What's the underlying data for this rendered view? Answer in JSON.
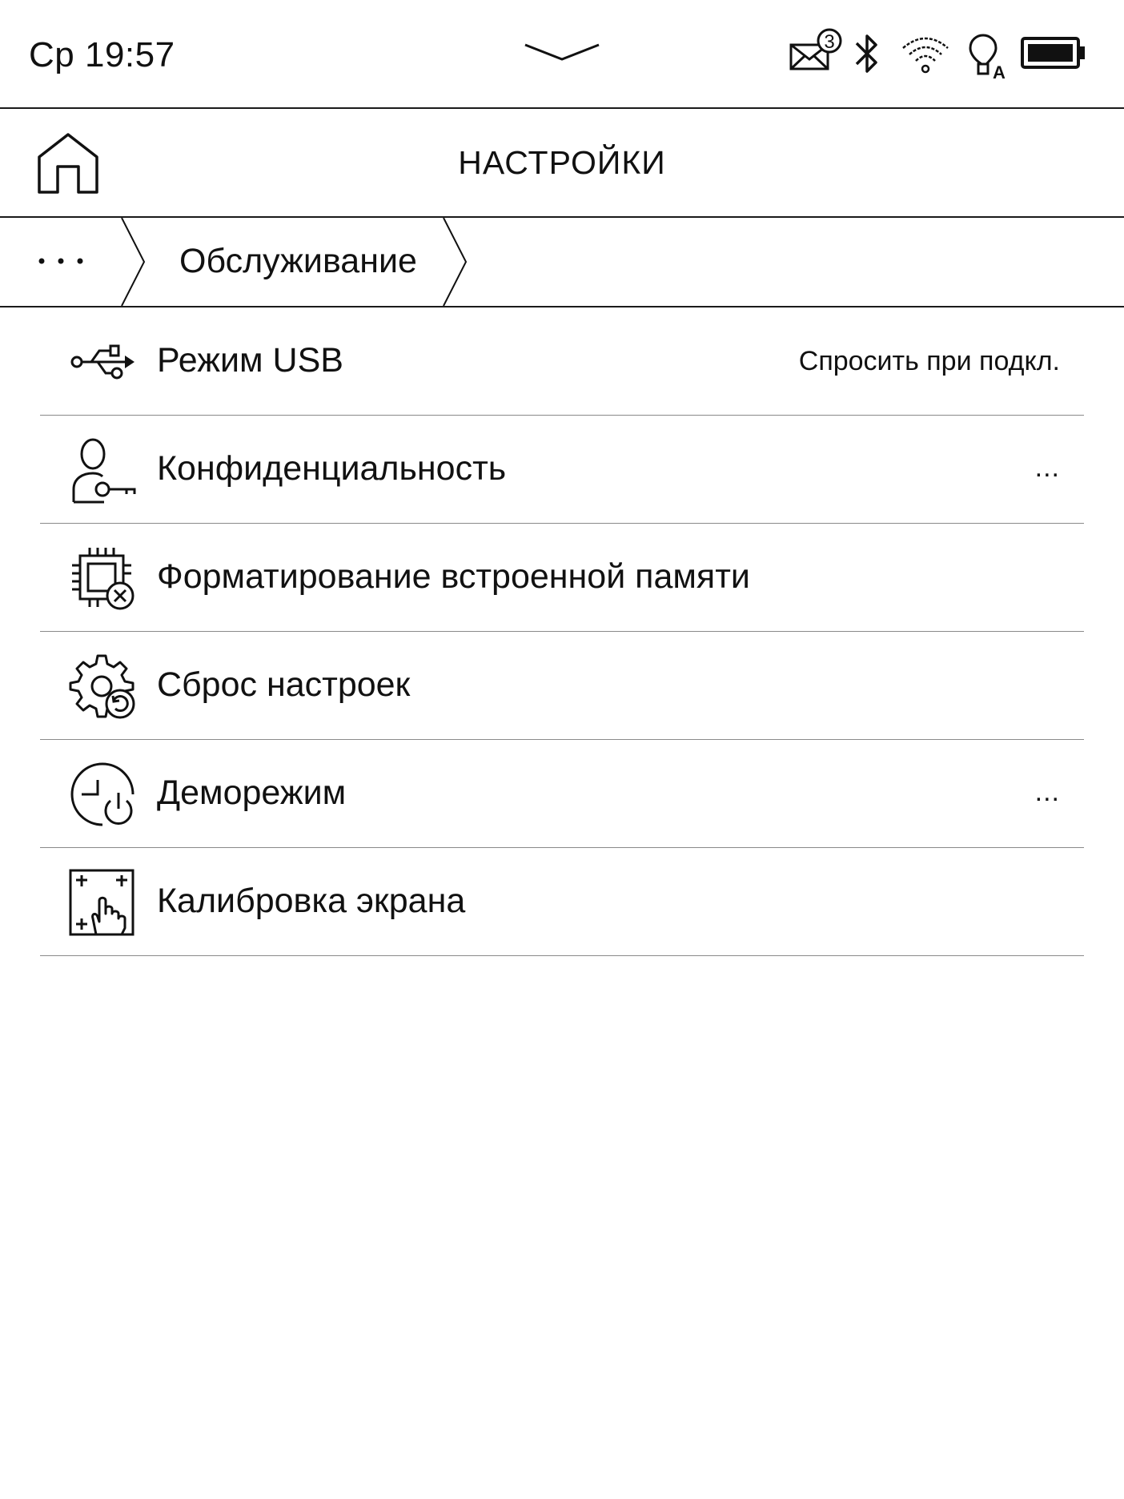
{
  "status_bar": {
    "time": "Ср 19:57",
    "mail_count": "3",
    "light_mode_letter": "A",
    "icons": [
      "panel-toggle-icon",
      "mail-icon",
      "bluetooth-icon",
      "wifi-icon",
      "frontlight-auto-icon",
      "battery-icon"
    ]
  },
  "header": {
    "title": "НАСТРОЙКИ",
    "home_icon": "home-icon"
  },
  "breadcrumb": {
    "more": "…",
    "current": "Обслуживание"
  },
  "items": [
    {
      "label": "Режим USB",
      "value": "Спросить при подкл.",
      "icon": "usb-icon"
    },
    {
      "label": "Конфиденциальность",
      "value": "...",
      "icon": "privacy-key-icon"
    },
    {
      "label": "Форматирование встроенной памяти",
      "value": "",
      "icon": "format-memory-icon"
    },
    {
      "label": "Сброс настроек",
      "value": "",
      "icon": "reset-settings-icon"
    },
    {
      "label": "Деморежим",
      "value": "...",
      "icon": "demo-mode-icon"
    },
    {
      "label": "Калибровка экрана",
      "value": "",
      "icon": "screen-calibration-icon"
    }
  ]
}
